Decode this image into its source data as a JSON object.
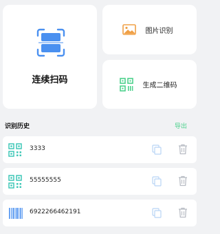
{
  "actions": {
    "scan_label": "连续扫码",
    "image_label": "图片识别",
    "generate_label": "生成二维码"
  },
  "history": {
    "title": "识别历史",
    "export_label": "导出",
    "items": [
      {
        "text": "3333",
        "type": "qr-code-icon"
      },
      {
        "text": "55555555",
        "type": "qr-code-icon"
      },
      {
        "text": "6922266462191",
        "type": "barcode-icon"
      }
    ]
  },
  "colors": {
    "accent_blue": "#4a90f0",
    "accent_green": "#4cd18c",
    "accent_orange": "#f0a046",
    "teal": "#3fc7b7",
    "muted": "#b8bcc4"
  }
}
